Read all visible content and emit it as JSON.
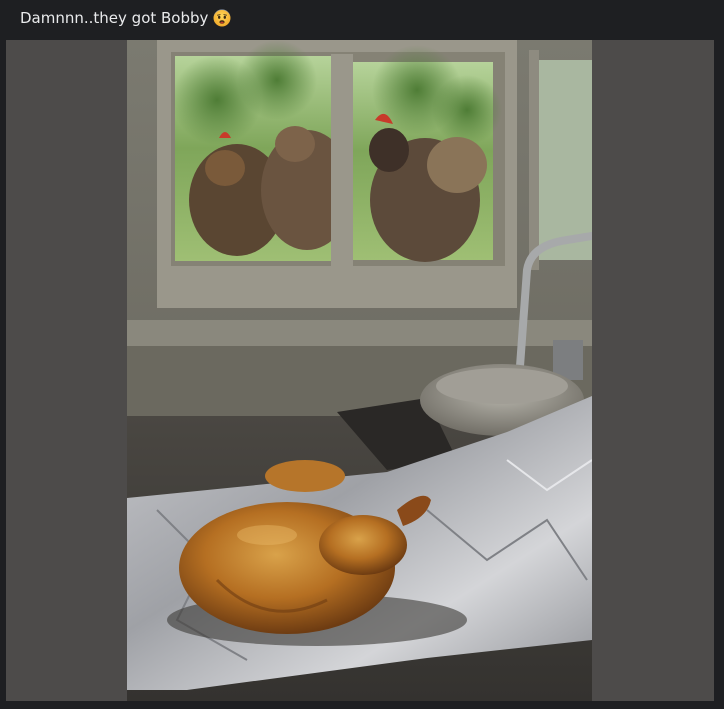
{
  "post": {
    "caption": "Damnnn..they got Bobby",
    "emoji_icon": "fearful-face-icon"
  },
  "image": {
    "depicts": "roast-chicken-watched-by-hens-photo"
  },
  "colors": {
    "page_bg": "#1e1f22",
    "caption_text": "#e9eaec",
    "media_frame": "#4d4b4a"
  }
}
